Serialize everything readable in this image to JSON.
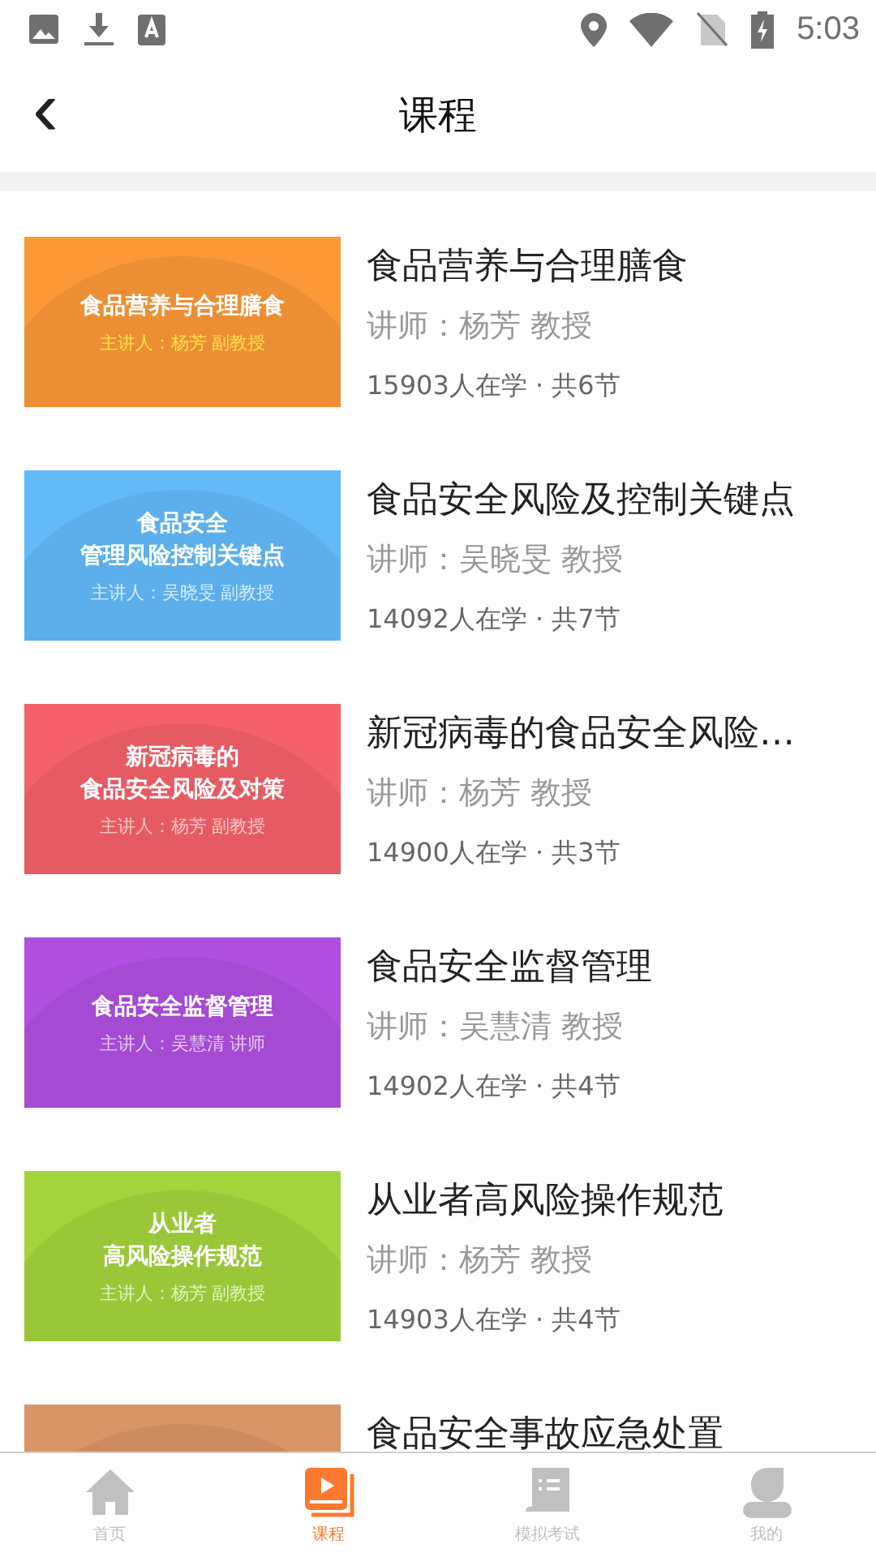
{
  "status_bar": {
    "time": "5:03"
  },
  "header": {
    "back": "‹",
    "title": "课程"
  },
  "courses": [
    {
      "title": "食品营养与合理膳食",
      "teacher": "讲师：杨芳 教授",
      "stats": "15903人在学 · 共6节",
      "cover": {
        "color": "#fb9838",
        "lines": [
          "食品营养与合理膳食"
        ],
        "speaker": {
          "text": "主讲人：杨芳 副教授",
          "color": "#ffe24a"
        }
      }
    },
    {
      "title": "食品安全风险及控制关键点",
      "teacher": "讲师：吴晓旻 教授",
      "stats": "14092人在学 · 共7节",
      "cover": {
        "color": "#62baf9",
        "lines": [
          "食品安全",
          "管理风险控制关键点"
        ],
        "speaker": {
          "text": "主讲人：吴晓旻 副教授",
          "color": "#d4ecfd"
        }
      }
    },
    {
      "title": "新冠病毒的食品安全风险…",
      "teacher": "讲师：杨芳 教授",
      "stats": "14900人在学 · 共3节",
      "cover": {
        "color": "#f5616a",
        "lines": [
          "新冠病毒的",
          "食品安全风险及对策"
        ],
        "speaker": {
          "text": "主讲人：杨芳 副教授",
          "color": "#fcc6c9"
        }
      }
    },
    {
      "title": "食品安全监督管理",
      "teacher": "讲师：吴慧清 教授",
      "stats": "14902人在学 · 共4节",
      "cover": {
        "color": "#b04fe0",
        "lines": [
          "食品安全监督管理"
        ],
        "speaker": {
          "text": "主讲人：吴慧清 讲师",
          "color": "#e6c8f5"
        }
      }
    },
    {
      "title": "从业者高风险操作规范",
      "teacher": "讲师：杨芳 教授",
      "stats": "14903人在学 · 共4节",
      "cover": {
        "color": "#a3d43c",
        "lines": [
          "从业者",
          "高风险操作规范"
        ],
        "speaker": {
          "text": "主讲人：杨芳 副教授",
          "color": "#e3f2c0"
        }
      }
    },
    {
      "title": "食品安全事故应急处置",
      "cover": {
        "color": "#d99566"
      }
    }
  ],
  "tabs": [
    {
      "label": "首页",
      "kind": "home",
      "selected": false
    },
    {
      "label": "课程",
      "kind": "course",
      "selected": true
    },
    {
      "label": "模拟考试",
      "kind": "exam",
      "selected": false
    },
    {
      "label": "我的",
      "kind": "me",
      "selected": false
    }
  ]
}
